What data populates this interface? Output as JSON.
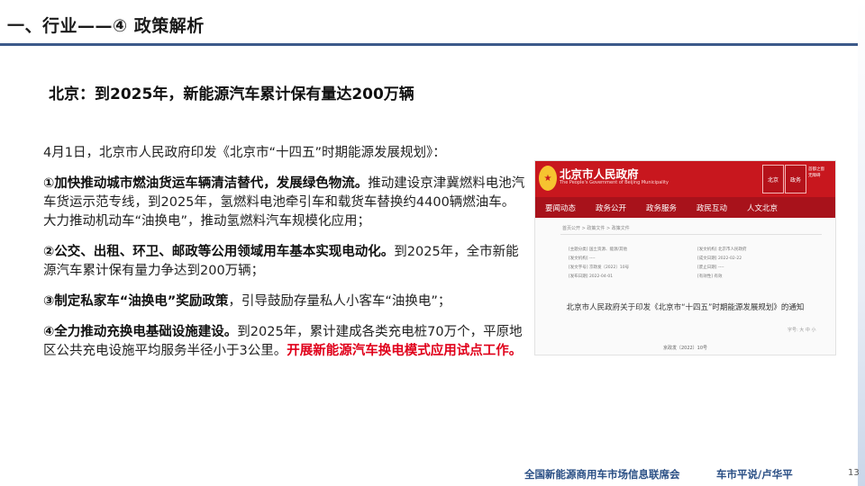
{
  "header": {
    "title": "一、行业——④ 政策解析"
  },
  "subtitle": "北京：到2025年，新能源汽车累计保有量达200万辆",
  "intro": "4月1日，北京市人民政府印发《北京市“十四五”时期能源发展规划》：",
  "points": [
    {
      "bold": "①加快推动城市燃油货运车辆清洁替代，发展绿色物流。",
      "text": "推动建设京津冀燃料电池汽车货运示范专线，到2025年，氢燃料电池牵引车和载货车替换约4400辆燃油车。大力推动机动车“油换电”，推动氢燃料汽车规模化应用；"
    },
    {
      "bold": "②公交、出租、环卫、邮政等公用领域用车基本实现电动化。",
      "text": "到2025年，全市新能源汽车累计保有量力争达到200万辆；"
    },
    {
      "bold": "③制定私家车“油换电”奖励政策",
      "text": "，引导鼓励存量私人小客车“油换电”；"
    },
    {
      "bold": "④全力推动充换电基础设施建设。",
      "text": "到2025年，累计建成各类充电桩70万个，平原地区公共充电设施平均服务半径小于3公里。",
      "highlight": "开展新能源汽车换电模式应用试点工作。"
    }
  ],
  "screenshot": {
    "site_name": "北京市人民政府",
    "site_sub": "The People's Government of Beijing Municipality",
    "emblem_icon": "national-emblem",
    "head_boxes": [
      "北京",
      "政务"
    ],
    "head_small": [
      "首都之窗",
      "无障碍"
    ],
    "nav": [
      "要闻动态",
      "政务公开",
      "政务服务",
      "政民互动",
      "人文北京"
    ],
    "breadcrumb": "首页公开 > 政策文件 > 政策文件",
    "meta_left": [
      "[主题分类] 国土资源、能源/其他",
      "[发文机构] ----",
      "[发文字号] 京政发〔2022〕10号",
      "[发布日期] 2022-04-01"
    ],
    "meta_right": [
      "[发文机构] 北京市人民政府",
      "[成文日期] 2022-02-22",
      "[废止日期] ----",
      "[有效性] 有效"
    ],
    "doc_title": "北京市人民政府关于印发《北京市“十四五”时期能源发展规划》的通知",
    "doc_tools": "字号: 大 中 小",
    "doc_no": "京政发〔2022〕10号"
  },
  "footer": {
    "org": "全国新能源商用车市场信息联席会",
    "author": "车市平说/卢华平",
    "page": "13"
  },
  "colors": {
    "accent_red": "#e0001a",
    "title_rule": "#3c5a8a",
    "footer_blue": "#2a4f85",
    "gov_red": "#c8171e"
  }
}
